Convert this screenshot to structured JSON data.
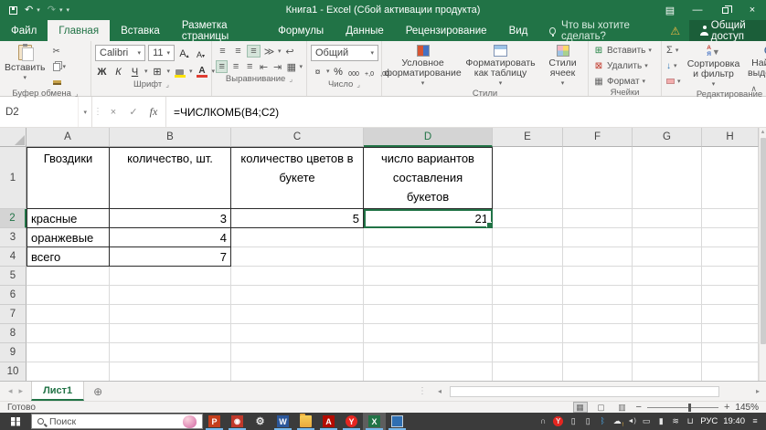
{
  "icons": {
    "undo": "↶",
    "redo": "↷",
    "dropdown": "▾",
    "minimize": "—",
    "close": "×",
    "ribbon_options": "▤",
    "warning": "⚠",
    "cut": "✂",
    "check": "✓",
    "cancel": "×",
    "fx": "fx",
    "sum": "Σ",
    "fill_down": "↓",
    "borders": "⊞",
    "currency": "¤",
    "percent": "%",
    "thousands": "000",
    "dec_inc": "+,0",
    "dec_dec": ",00",
    "grow_font": "А",
    "shrink_font": "А",
    "tri_up": "▴",
    "tri_down": "▾",
    "align_bars": "≡",
    "orientation": "≫",
    "wrap_text": "↩",
    "indent_dec": "⇤",
    "indent_inc": "⇥",
    "merge": "▦",
    "insert_cells": "⊞",
    "delete_cells": "⊠",
    "format_cells": "▦",
    "sort_a": "А",
    "sort_z": "Я",
    "funnel": "▼",
    "collapse": "∧",
    "launcher": "⌟",
    "dots": "⋮",
    "prev": "◂",
    "next": "▸",
    "up": "▴",
    "add_sheet": "⊕",
    "minus": "−",
    "plus": "+",
    "view_normal": "▦",
    "view_layout": "▢",
    "view_break": "▥",
    "gear": "⚙",
    "camera": "◉",
    "ppt": "P",
    "word": "W",
    "acrobat": "A",
    "yandex": "Y",
    "excel": "X",
    "headset": "∩",
    "phone": "▯",
    "tablet": "▯",
    "bluetooth": "ᛒ",
    "cloud": "☁",
    "cloud_warn": "!",
    "volume": "◄)",
    "battery": "▭",
    "mic": "▮",
    "network": "≋",
    "usb": "⊔",
    "notif": "≡"
  },
  "titlebar": {
    "title": "Книга1 - Excel (Сбой активации продукта)"
  },
  "tabs": [
    "Файл",
    "Главная",
    "Вставка",
    "Разметка страницы",
    "Формулы",
    "Данные",
    "Рецензирование",
    "Вид"
  ],
  "tell_me": "Что вы хотите сделать?",
  "share": "Общий доступ",
  "ribbon": {
    "paste": "Вставить",
    "clipboard_group": "Буфер обмена",
    "font_name": "Calibri",
    "font_size": "11",
    "bold": "Ж",
    "italic": "К",
    "underline": "Ч",
    "font_color_letter": "А",
    "font_group": "Шрифт",
    "align_group": "Выравнивание",
    "number_format": "Общий",
    "number_group": "Число",
    "cond_format": "Условное форматирование",
    "format_table": "Форматировать как таблицу",
    "cell_styles": "Стили ячеек",
    "styles_group": "Стили",
    "insert": "Вставить",
    "delete": "Удалить",
    "format": "Формат",
    "cells_group": "Ячейки",
    "sort_filter": "Сортировка и фильтр",
    "find_select": "Найти и выделить",
    "editing_group": "Редактирование"
  },
  "formula_bar": {
    "name_box": "D2",
    "formula": "=ЧИСЛКОМБ(B4;C2)"
  },
  "sheet": {
    "columns": [
      "A",
      "B",
      "C",
      "D",
      "E",
      "F",
      "G",
      "H"
    ],
    "rows": [
      "1",
      "2",
      "3",
      "4",
      "5",
      "6",
      "7",
      "8",
      "9",
      "10"
    ],
    "cells": {
      "A1": "Гвоздики",
      "B1": "количество, шт.",
      "C1": "количество цветов в букете",
      "D1": "число вариантов составления букетов",
      "A2": "красные",
      "B2": "3",
      "C2": "5",
      "D2": "21",
      "A3": "оранжевые",
      "B3": "4",
      "A4": "всего",
      "B4": "7"
    },
    "selection": {
      "cell": "D2",
      "column": "D",
      "row": "2"
    }
  },
  "sheet_tabs": {
    "active": "Лист1"
  },
  "status": {
    "mode": "Готово",
    "zoom": "145%"
  },
  "taskbar": {
    "search": "Поиск",
    "lang": "РУС",
    "time": "19:40"
  },
  "colors": {
    "accent_green": "#217346",
    "selection": "#217346",
    "fill_yellow": "#ffe400",
    "font_red": "#e03c31"
  }
}
